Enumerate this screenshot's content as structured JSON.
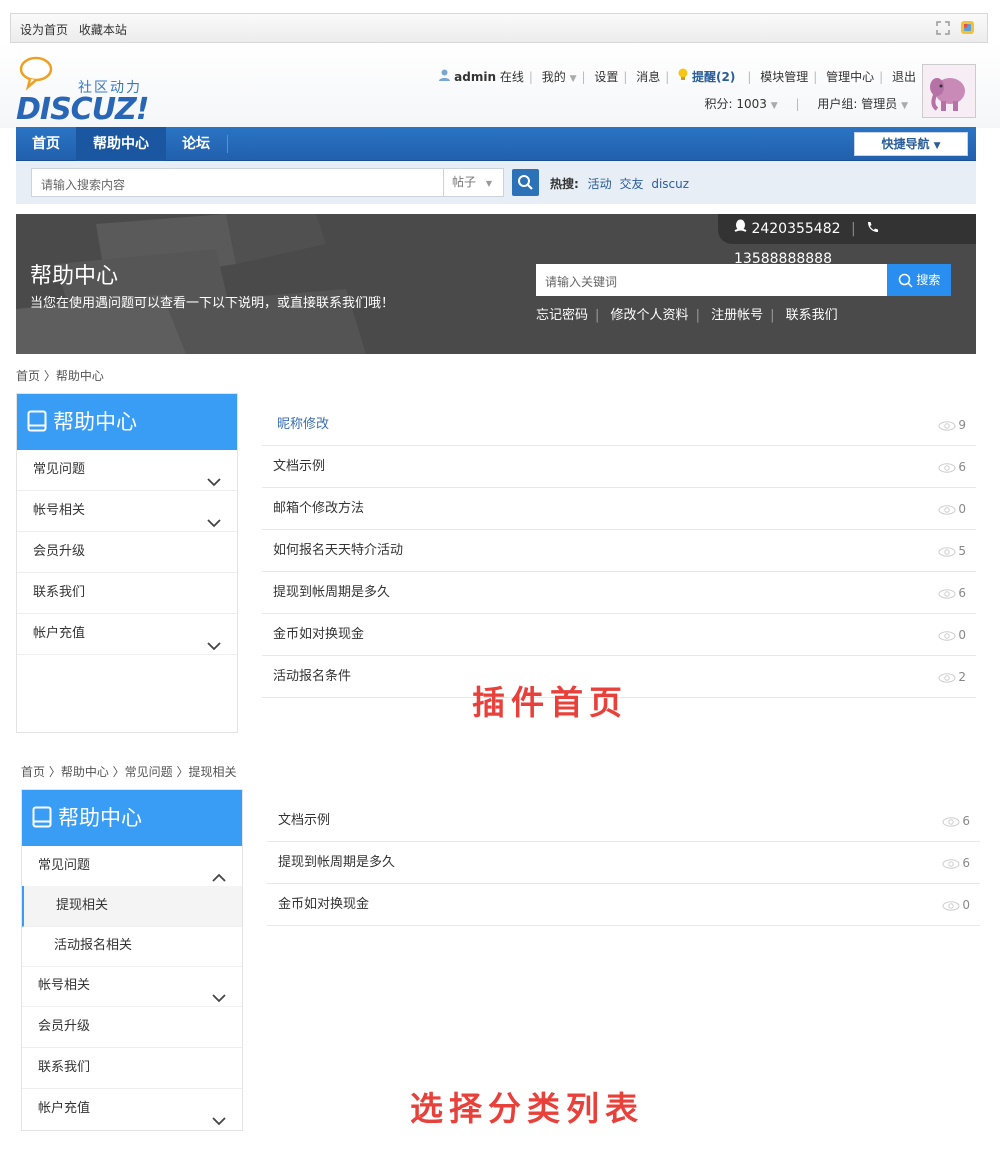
{
  "topbar": {
    "set_home": "设为首页",
    "bookmark": "收藏本站"
  },
  "logo": {
    "sub": "社区动力",
    "name": "DISCUZ!"
  },
  "userbar": {
    "username": "admin",
    "status": "在线",
    "my": "我的",
    "settings": "设置",
    "messages": "消息",
    "remind": "提醒(2)",
    "module_admin": "模块管理",
    "admin_center": "管理中心",
    "logout": "退出",
    "points": "积分: 1003",
    "usergroup": "用户组: 管理员"
  },
  "nav": {
    "home": "首页",
    "help": "帮助中心",
    "forum": "论坛",
    "quick": "快捷导航"
  },
  "search": {
    "placeholder": "请输入搜索内容",
    "type": "帖子",
    "hot_label": "热搜:",
    "hot": [
      "活动",
      "交友",
      "discuz"
    ]
  },
  "banner": {
    "qq": "2420355482",
    "phone": "13588888888",
    "title": "帮助中心",
    "subtitle": "当您在使用遇问题可以查看一下以下说明，或直接联系我们哦！",
    "search_placeholder": "请输入关键词",
    "search_button": "搜索",
    "links": [
      "忘记密码",
      "修改个人资料",
      "注册帐号",
      "联系我们"
    ]
  },
  "page1": {
    "breadcrumb": "首页 〉帮助中心",
    "sidebar_title": "帮助中心",
    "sidebar_items": [
      "常见问题",
      "帐号相关",
      "会员升级",
      "联系我们",
      "帐户充值"
    ],
    "articles": [
      {
        "title": "昵称修改",
        "views": "9"
      },
      {
        "title": "文档示例",
        "views": "6"
      },
      {
        "title": "邮箱个修改方法",
        "views": "0"
      },
      {
        "title": "如何报名天天特介活动",
        "views": "5"
      },
      {
        "title": "提现到帐周期是多久",
        "views": "6"
      },
      {
        "title": "金币如对换现金",
        "views": "0"
      },
      {
        "title": "活动报名条件",
        "views": "2"
      }
    ],
    "caption": "插件首页"
  },
  "page2": {
    "breadcrumb": "首页 〉帮助中心 〉常见问题 〉提现相关",
    "sidebar_title": "帮助中心",
    "sidebar_items": [
      "常见问题",
      "提现相关",
      "活动报名相关",
      "帐号相关",
      "会员升级",
      "联系我们",
      "帐户充值"
    ],
    "articles": [
      {
        "title": "文档示例",
        "views": "6"
      },
      {
        "title": "提现到帐周期是多久",
        "views": "6"
      },
      {
        "title": "金币如对换现金",
        "views": "0"
      }
    ],
    "caption": "选择分类列表"
  },
  "colors": {
    "accent": "#3a9df5",
    "nav": "#2468b4",
    "caption": "#e8403a",
    "banner": "#4a4a4a"
  }
}
